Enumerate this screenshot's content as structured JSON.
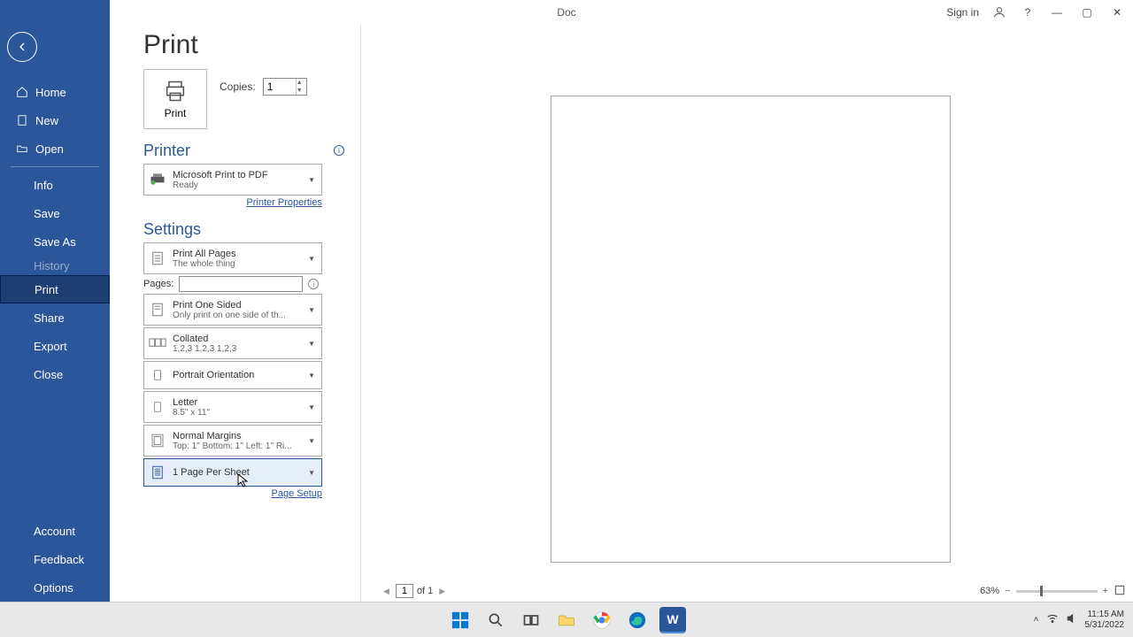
{
  "title_doc": "Doc",
  "signin": "Sign in",
  "sidebar": {
    "items": [
      "Home",
      "New",
      "Open",
      "Info",
      "Save",
      "Save As",
      "History",
      "Print",
      "Share",
      "Export",
      "Close"
    ],
    "bottom": [
      "Account",
      "Feedback",
      "Options"
    ]
  },
  "heading": "Print",
  "print_btn": "Print",
  "copies_label": "Copies:",
  "copies_value": "1",
  "printer_h": "Printer",
  "printer": {
    "name": "Microsoft Print to PDF",
    "status": "Ready"
  },
  "printer_props": "Printer Properties",
  "settings_h": "Settings",
  "pages_label": "Pages:",
  "pages_value": "",
  "dd": {
    "scope": {
      "t": "Print All Pages",
      "s": "The whole thing"
    },
    "sided": {
      "t": "Print One Sided",
      "s": "Only print on one side of th..."
    },
    "collated": {
      "t": "Collated",
      "s": "1,2,3    1,2,3    1,2,3"
    },
    "orient": {
      "t": "Portrait Orientation",
      "s": ""
    },
    "paper": {
      "t": "Letter",
      "s": "8.5\" x 11\""
    },
    "margins": {
      "t": "Normal Margins",
      "s": "Top: 1\" Bottom: 1\" Left: 1\" Ri..."
    },
    "pps": {
      "t": "1 Page Per Sheet",
      "s": ""
    }
  },
  "page_setup": "Page Setup",
  "nav": {
    "page": "1",
    "of": "of 1"
  },
  "zoom": "63%",
  "clock": {
    "time": "11:15 AM",
    "date": "5/31/2022"
  }
}
